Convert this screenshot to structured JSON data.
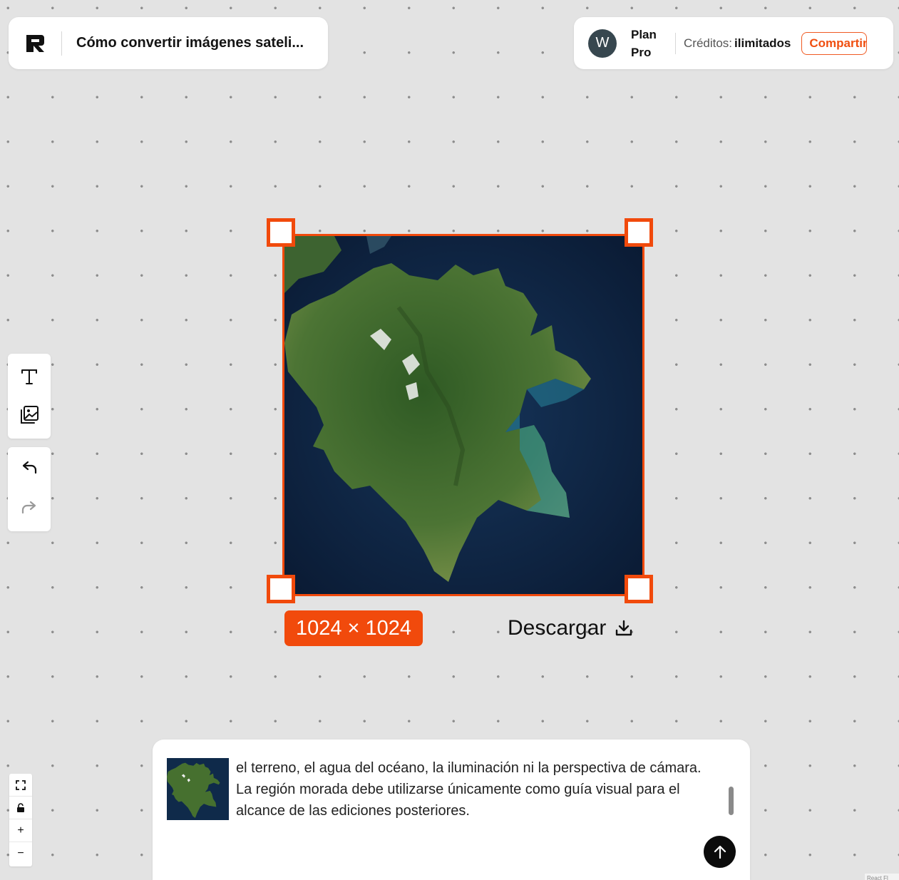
{
  "document": {
    "title": "Cómo convertir imágenes sateli..."
  },
  "account": {
    "avatar_initial": "W",
    "plan_label": "Plan Pro",
    "credits_label": "Créditos:",
    "credits_value": "ilimitados",
    "share_label": "Compartir"
  },
  "toolbar": {
    "tools": [
      {
        "icon": "text-icon"
      },
      {
        "icon": "image-gallery-icon"
      },
      {
        "icon": "undo-icon"
      },
      {
        "icon": "redo-icon"
      }
    ]
  },
  "canvas": {
    "image_size_label": "1024 × 1024",
    "download_label": "Descargar",
    "image_description_icon": "satellite-island-image"
  },
  "zoom_controls": {
    "fit_icon": "fullscreen-icon",
    "lock_icon": "lock-icon",
    "zoom_in_label": "+",
    "zoom_out_label": "−"
  },
  "prompt": {
    "text": "el terreno, el agua del océano, la iluminación ni la perspectiva de cámara. La región morada debe utilizarse únicamente como guía visual para el alcance de las ediciones posteriores.",
    "send_icon": "arrow-up-icon"
  },
  "footer": {
    "corner_text": "React Fl"
  },
  "colors": {
    "accent": "#f14a0c",
    "canvas_bg": "#e3e3e3",
    "avatar_bg": "#37474f",
    "ocean": "#0c1f3a",
    "land": "#3f6a2c"
  }
}
